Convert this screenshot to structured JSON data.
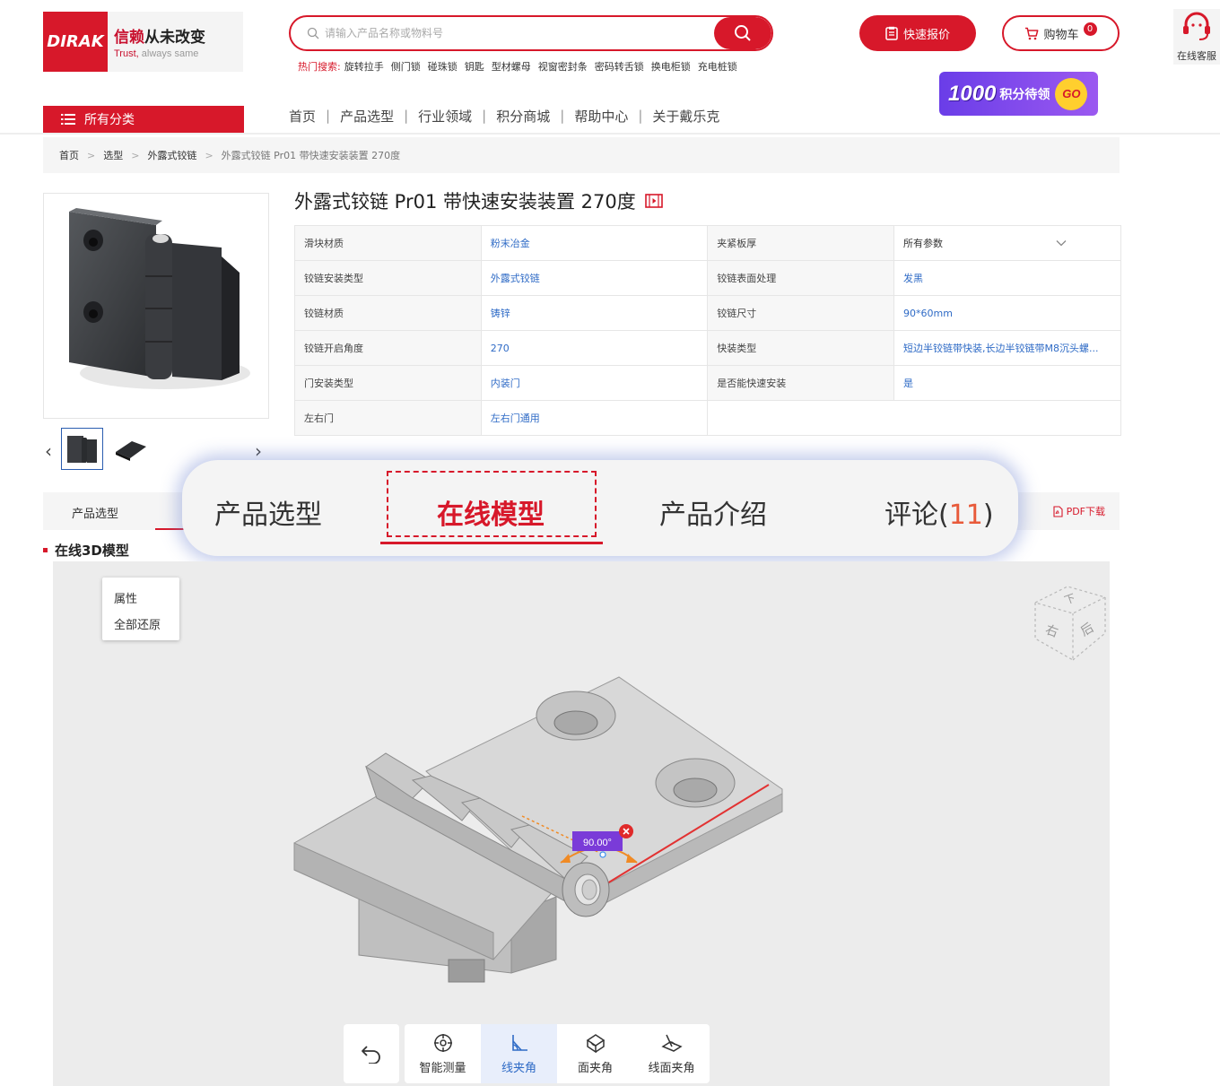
{
  "brand": {
    "logo_text": "DIRAK",
    "slogan_red": "信赖",
    "slogan_black": "从未改变",
    "tagline_red": "Trust,",
    "tagline_gray": "always same",
    "accent_color": "#d7182a"
  },
  "search": {
    "placeholder": "请输入产品名称或物料号",
    "hot_label": "热门搜索:",
    "hot_terms": [
      "旋转拉手",
      "侧门锁",
      "碰珠锁",
      "钥匙",
      "型材螺母",
      "视窗密封条",
      "密码转舌锁",
      "换电柜锁",
      "充电桩锁"
    ]
  },
  "header": {
    "quote_label": "快速报价",
    "cart_label": "购物车",
    "cart_count": "0",
    "service_label": "在线客服",
    "promo_number": "1000",
    "promo_text": "积分待领",
    "promo_go": "GO"
  },
  "nav": {
    "all_categories": "所有分类",
    "items": [
      "首页",
      "产品选型",
      "行业领域",
      "积分商城",
      "帮助中心",
      "关于戴乐克"
    ],
    "separator": "|"
  },
  "breadcrumb": {
    "items": [
      "首页",
      "选型",
      "外露式铰链",
      "外露式铰链 Pr01 带快速安装装置 270度"
    ],
    "separator": ">"
  },
  "product": {
    "title": "外露式铰链 Pr01 带快速安装装置 270度",
    "specs": [
      {
        "k1": "滑块材质",
        "v1": "粉末冶金",
        "k2": "夹紧板厚",
        "v2": "所有参数"
      },
      {
        "k1": "铰链安装类型",
        "v1": "外露式铰链",
        "k2": "铰链表面处理",
        "v2": "发黑"
      },
      {
        "k1": "铰链材质",
        "v1": "铸锌",
        "k2": "铰链尺寸",
        "v2": "90*60mm"
      },
      {
        "k1": "铰链开启角度",
        "v1": "270",
        "k2": "快装类型",
        "v2": "短边半铰链带快装,长边半铰链带M8沉头螺..."
      },
      {
        "k1": "门安装类型",
        "v1": "内装门",
        "k2": "是否能快速安装",
        "v2": "是"
      },
      {
        "k1": "左右门",
        "v1": "左右门通用",
        "k2": "",
        "v2": ""
      }
    ]
  },
  "tabs": {
    "band_first": "产品选型",
    "pdf_label": "PDF下载",
    "callout": [
      {
        "label": "产品选型"
      },
      {
        "label": "在线模型"
      },
      {
        "label": "产品介绍"
      },
      {
        "label": "评论(",
        "count": "11",
        "suffix": ")"
      }
    ]
  },
  "viewer": {
    "section_title": "在线3D模型",
    "context_menu": [
      "属性",
      "全部还原"
    ],
    "angle_readout": "90.00°",
    "viewcube_faces": [
      "下",
      "右",
      "后"
    ],
    "tools": [
      {
        "label": "智能测量",
        "icon": "crosshair-icon"
      },
      {
        "label": "线夹角",
        "icon": "line-angle-icon"
      },
      {
        "label": "面夹角",
        "icon": "face-angle-icon"
      },
      {
        "label": "线面夹角",
        "icon": "line-face-angle-icon"
      }
    ],
    "active_tool": "线夹角"
  }
}
